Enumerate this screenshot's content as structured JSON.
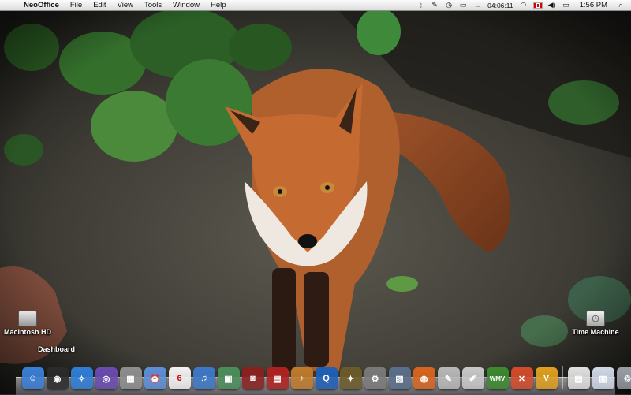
{
  "menubar": {
    "app_name": "NeoOffice",
    "menus": [
      "File",
      "Edit",
      "View",
      "Tools",
      "Window",
      "Help"
    ],
    "timer": "04:06:11",
    "clock": "1:56 PM",
    "extras_icons": [
      "bluetooth-icon",
      "script-icon",
      "time-machine-menu-icon",
      "display-icon",
      "timer-icon",
      "wifi-icon",
      "flag-icon",
      "volume-icon",
      "battery-icon",
      "spotlight-icon"
    ]
  },
  "desktop": {
    "hd_label": "Macintosh HD",
    "dashboard_label": "Dashboard",
    "time_machine_label": "Time Machine"
  },
  "dock": {
    "items": [
      {
        "name": "finder",
        "color": "#3a7fd6",
        "glyph": "☺"
      },
      {
        "name": "dashboard",
        "color": "#2b2b2b",
        "glyph": "◉"
      },
      {
        "name": "safari",
        "color": "#2f7fd8",
        "glyph": "✧"
      },
      {
        "name": "itunes-cd",
        "color": "#6a4bb0",
        "glyph": "◎"
      },
      {
        "name": "calculator",
        "color": "#8f8f8f",
        "glyph": "▦"
      },
      {
        "name": "alarm-clock",
        "color": "#5d8fd8",
        "glyph": "⏰"
      },
      {
        "name": "ical",
        "color": "#f2f2f2",
        "glyph": "6",
        "text_color": "#c00"
      },
      {
        "name": "itunes",
        "color": "#3c78c8",
        "glyph": "♫"
      },
      {
        "name": "iphoto",
        "color": "#4a8e5a",
        "glyph": "▣"
      },
      {
        "name": "photo-booth",
        "color": "#8a2020",
        "glyph": "◙"
      },
      {
        "name": "front-row",
        "color": "#b02020",
        "glyph": "▤"
      },
      {
        "name": "garageband",
        "color": "#c07a2a",
        "glyph": "♪"
      },
      {
        "name": "quicktime",
        "color": "#1e5fb8",
        "glyph": "Q"
      },
      {
        "name": "star-app",
        "color": "#6b5a2a",
        "glyph": "✦"
      },
      {
        "name": "system-preferences",
        "color": "#7a7a7a",
        "glyph": "⚙"
      },
      {
        "name": "preview",
        "color": "#5a6f8a",
        "glyph": "▧"
      },
      {
        "name": "firefox",
        "color": "#d8641e",
        "glyph": "◍"
      },
      {
        "name": "script-editor",
        "color": "#b8b8b8",
        "glyph": "✎"
      },
      {
        "name": "textedit",
        "color": "#c8c8c8",
        "glyph": "✐"
      },
      {
        "name": "wmv-player",
        "color": "#3b8a2e",
        "glyph": "WMV"
      },
      {
        "name": "crossover",
        "color": "#d44a2a",
        "glyph": "✕"
      },
      {
        "name": "vlc-app",
        "color": "#e0a020",
        "glyph": "V"
      }
    ],
    "right_items": [
      {
        "name": "documents-stack",
        "color": "#e0e0e0",
        "glyph": "▤"
      },
      {
        "name": "downloads-stack",
        "color": "#d0d8e8",
        "glyph": "▥"
      },
      {
        "name": "trash",
        "color": "#9aa0a8",
        "glyph": "♲"
      }
    ]
  }
}
